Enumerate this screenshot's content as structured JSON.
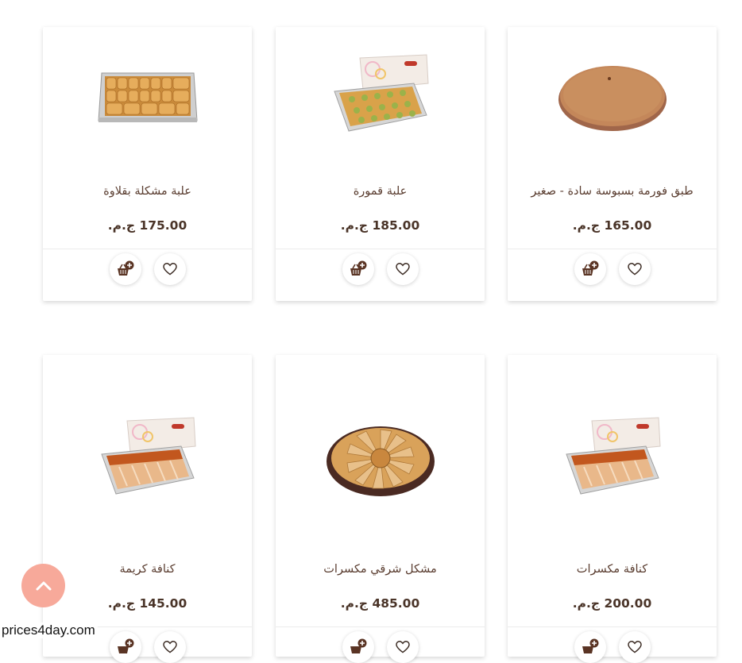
{
  "products": [
    {
      "name": "علبة مشكلة بقلاوة",
      "price": "175.00 ج.م.",
      "image": "baklava-box"
    },
    {
      "name": "علبة قمورة",
      "price": "185.00 ج.م.",
      "image": "pistachio-box"
    },
    {
      "name": "طبق فورمة بسبوسة سادة - صغير",
      "price": "165.00 ج.م.",
      "image": "basbousa-tray"
    },
    {
      "name": "كنافة كريمة",
      "price": "145.00 ج.م.",
      "image": "kunafa-box"
    },
    {
      "name": "مشكل شرقي مكسرات",
      "price": "485.00 ج.م.",
      "image": "mixed-tray"
    },
    {
      "name": "كنافة مكسرات",
      "price": "200.00 ج.م.",
      "image": "kunafa-box"
    }
  ],
  "icons": {
    "wishlist": "heart-icon",
    "add_to_cart": "basket-plus-icon",
    "scroll_top": "chevron-up-icon"
  },
  "colors": {
    "text": "#4a3428",
    "scroll_top_bg": "#f7a99a"
  },
  "watermark": "prices4day.com"
}
